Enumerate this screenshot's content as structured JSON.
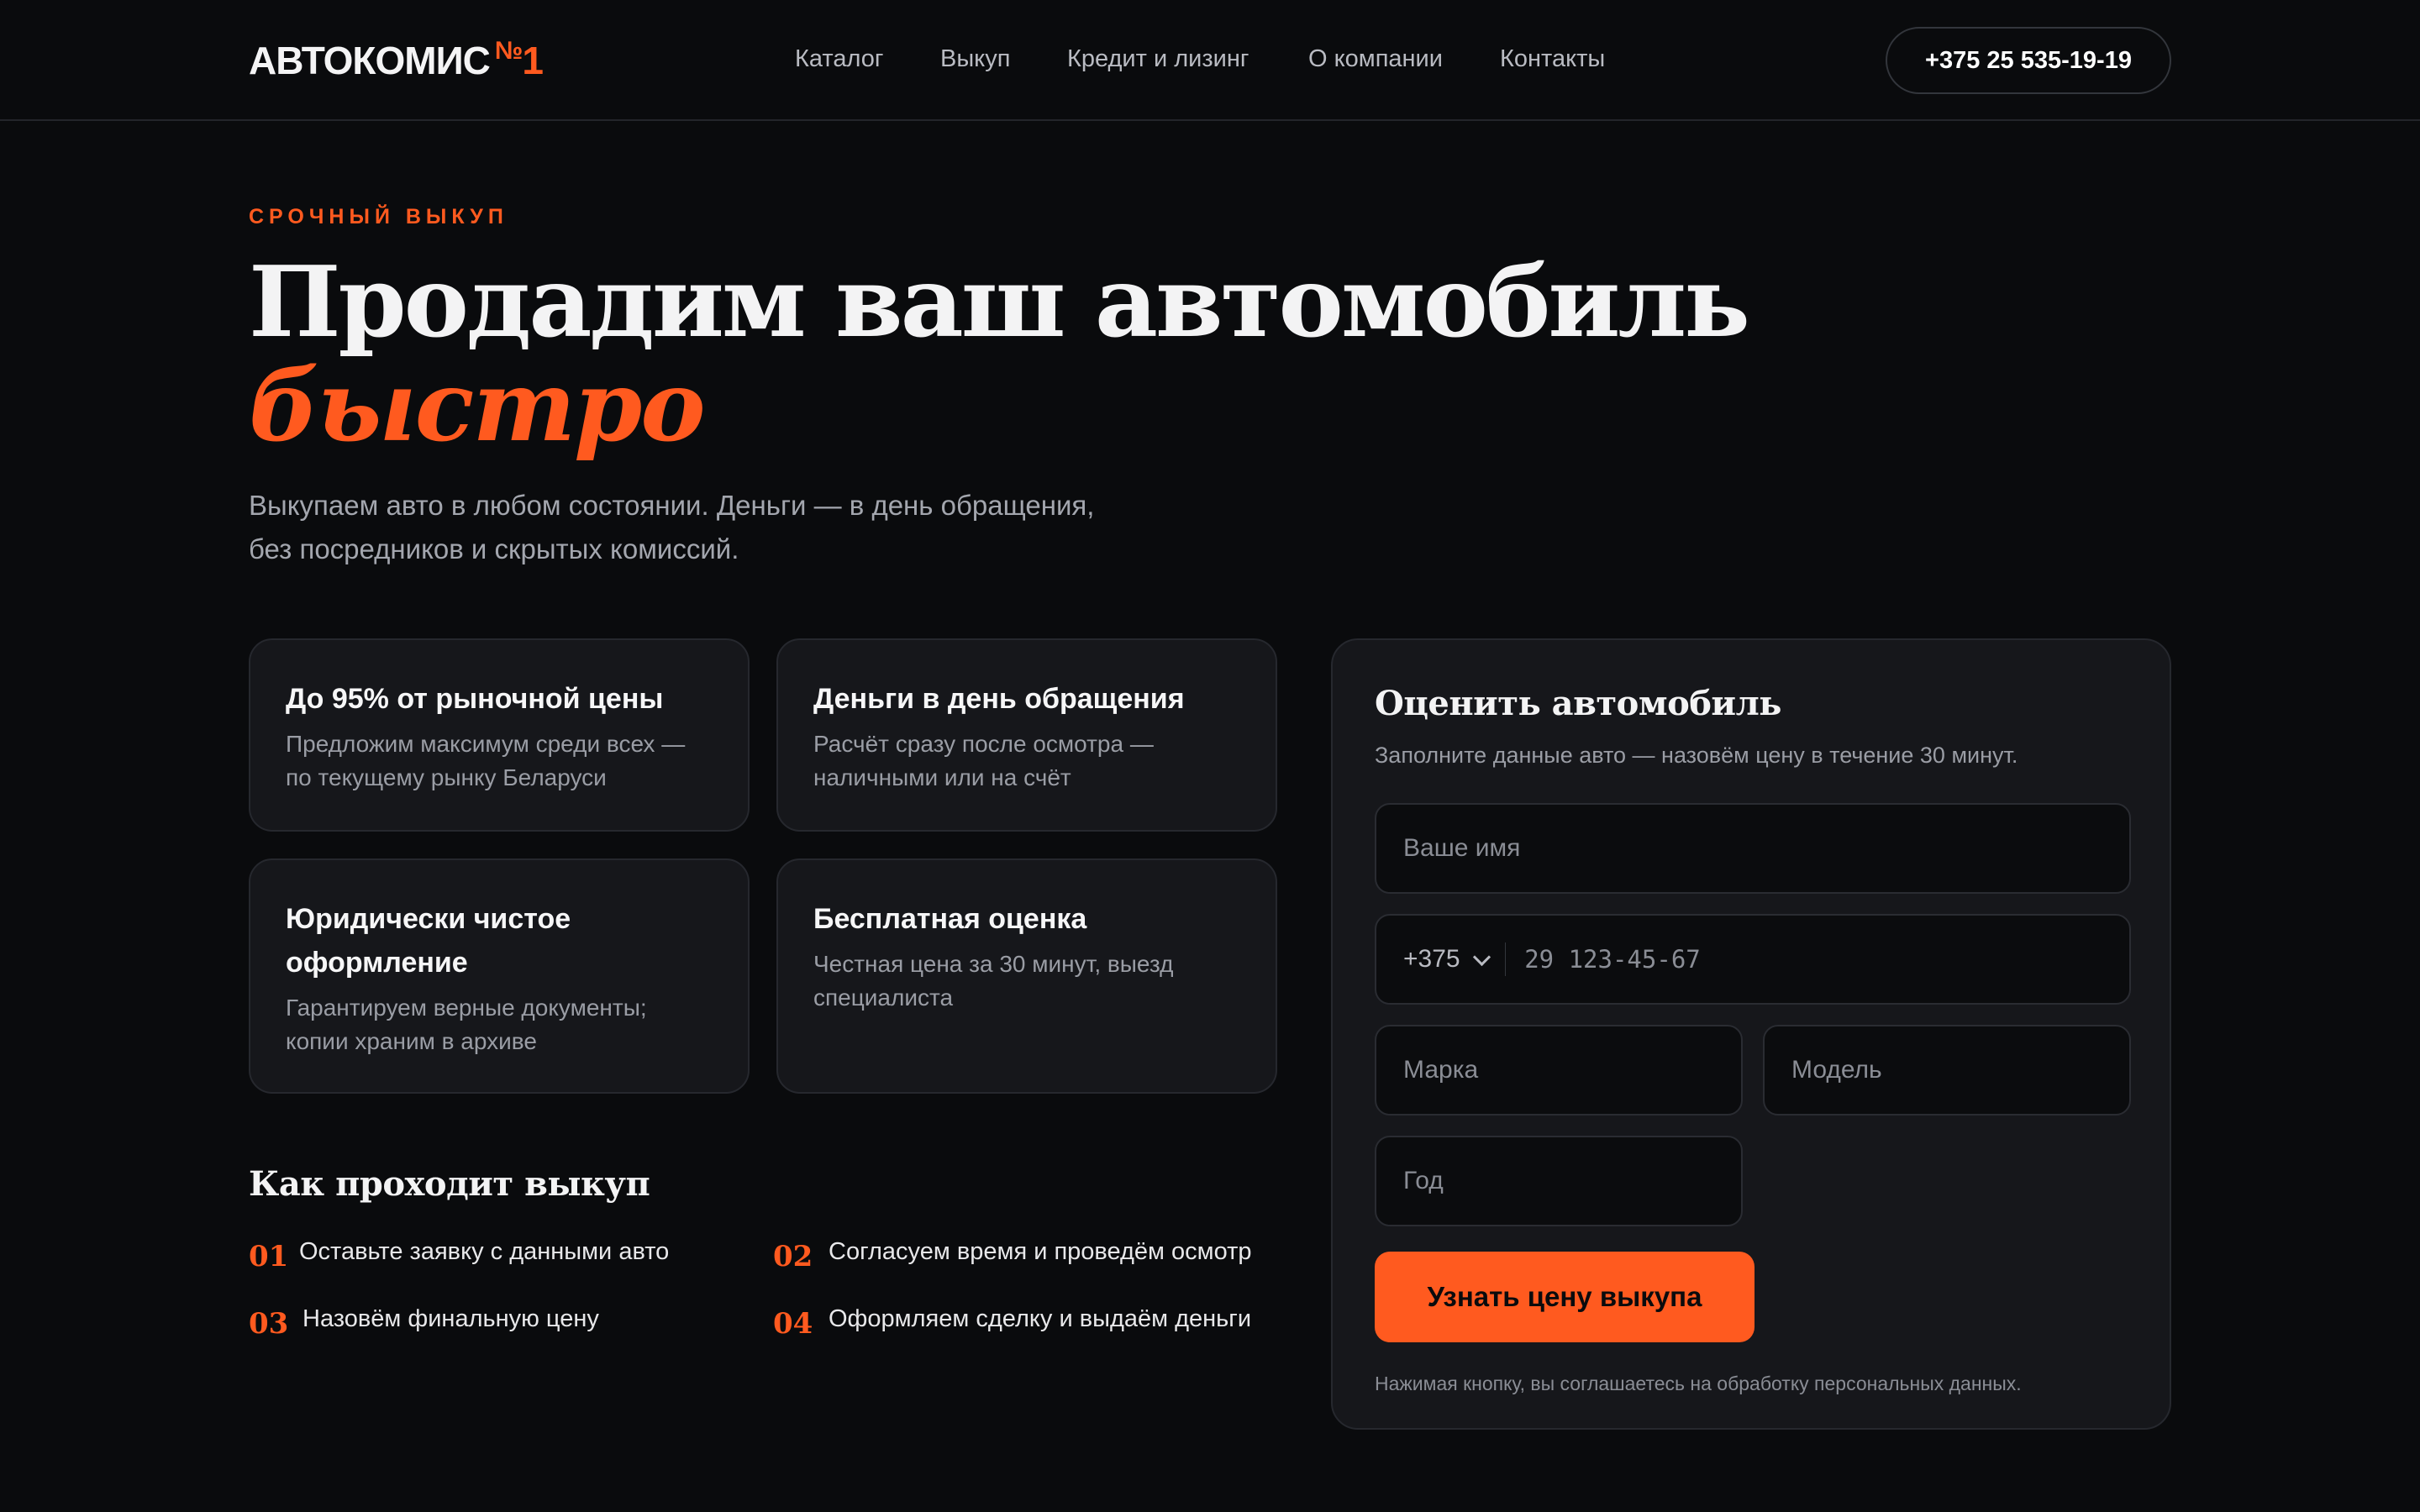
{
  "brand": {
    "name": "АВТОКОМИС",
    "number_sign": "№",
    "number": "1",
    "accent_color": "#ff5a1f"
  },
  "nav": {
    "items": [
      {
        "label": "Каталог"
      },
      {
        "label": "Выкуп"
      },
      {
        "label": "Кредит и лизинг"
      },
      {
        "label": "О компании"
      },
      {
        "label": "Контакты"
      }
    ]
  },
  "header": {
    "phone": "+375 25 535-19-19"
  },
  "hero": {
    "eyebrow": "СРОЧНЫЙ ВЫКУП",
    "title": "Продадим ваш автомобиль",
    "title_accent": "быстро",
    "lead_line1": "Выкупаем авто в любом состоянии. Деньги — в день обращения,",
    "lead_line2": "без посредников и скрытых комиссий."
  },
  "features": [
    {
      "title": "До 95% от рыночной цены",
      "text": "Предложим максимум среди всех — по текущему рынку Беларуси"
    },
    {
      "title": "Деньги в день обращения",
      "text": "Расчёт сразу после осмотра — наличными или на счёт"
    },
    {
      "title": "Юридически чистое оформление",
      "text": "Гарантируем верные документы; копии храним в архиве"
    },
    {
      "title": "Бесплатная оценка",
      "text": "Честная цена за 30 минут, выезд специалиста"
    }
  ],
  "steps": {
    "title": "Как проходит выкуп",
    "items": [
      {
        "num": "01",
        "text": "Оставьте заявку с данными авто"
      },
      {
        "num": "02",
        "text": "Согласуем время и проведём осмотр"
      },
      {
        "num": "03",
        "text": "Назовём финальную цену"
      },
      {
        "num": "04",
        "text": "Оформляем сделку и выдаём деньги"
      }
    ]
  },
  "form": {
    "title": "Оценить автомобиль",
    "subtitle": "Заполните данные авто — назовём цену в течение 30 минут.",
    "name_placeholder": "Ваше имя",
    "country_code": "+375",
    "phone_placeholder": "29 123-45-67",
    "make_placeholder": "Марка",
    "model_placeholder": "Модель",
    "year_placeholder": "Год",
    "submit_label": "Узнать цену выкупа",
    "legal": "Нажимая кнопку, вы соглашаетесь на обработку персональных данных."
  }
}
